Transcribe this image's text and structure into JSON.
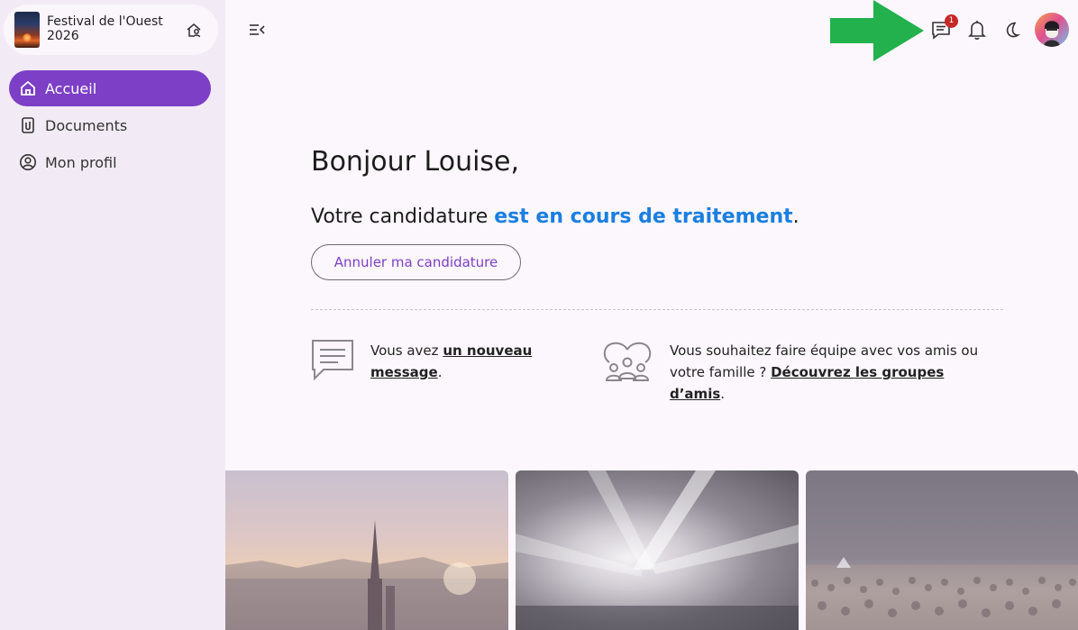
{
  "sidebar": {
    "org_name": "Festival de l'Ouest 2026",
    "items": [
      {
        "label": "Accueil",
        "icon": "home-icon",
        "active": true
      },
      {
        "label": "Documents",
        "icon": "documents-icon",
        "active": false
      },
      {
        "label": "Mon profil",
        "icon": "profile-icon",
        "active": false
      }
    ]
  },
  "topbar": {
    "messages_badge": "1",
    "icons": [
      "menu-collapse-icon",
      "messages-icon",
      "bell-icon",
      "dark-mode-icon"
    ]
  },
  "main": {
    "greeting": "Bonjour Louise,",
    "status_prefix": "Votre candidature ",
    "status_highlight": "est en cours de traitement",
    "status_suffix": ".",
    "cancel_label": "Annuler ma candidature",
    "message_prefix": "Vous avez ",
    "message_link": "un nouveau message",
    "message_suffix": ".",
    "groups_prefix": "Vous souhaitez faire équipe avec vos amis ou votre famille ? ",
    "groups_link": "Découvrez les groupes d’amis",
    "groups_suffix": "."
  },
  "colors": {
    "accent": "#7c3fc6",
    "status_blue": "#1a7fe0",
    "badge_red": "#c62828",
    "arrow_green": "#22b14c"
  }
}
